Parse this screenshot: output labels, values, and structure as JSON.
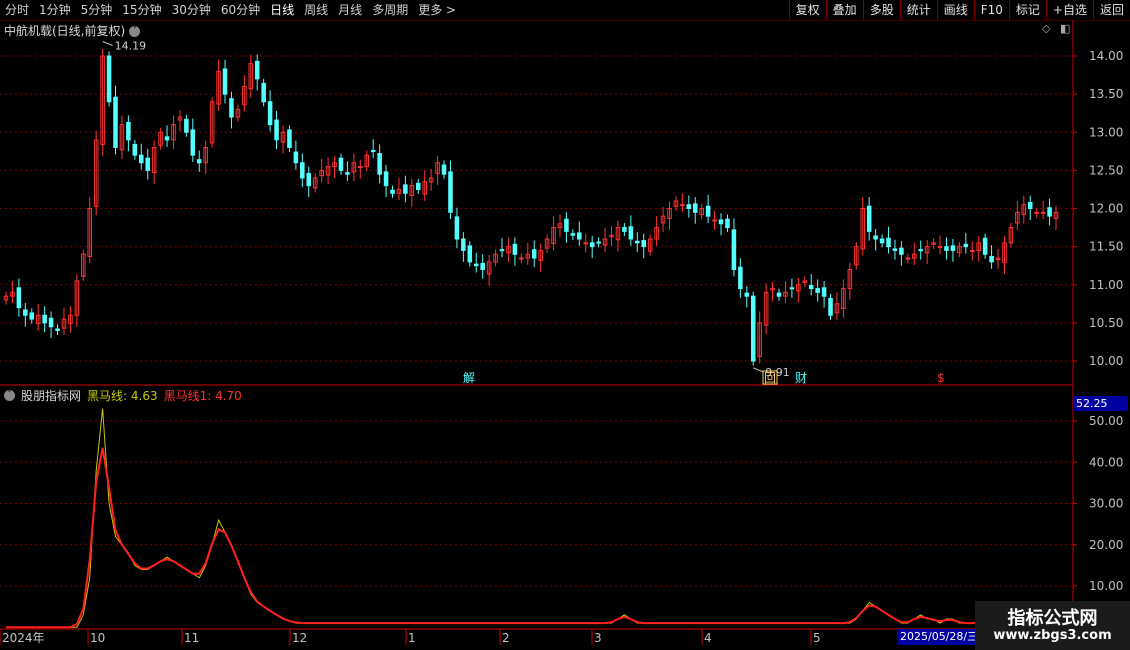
{
  "toolbar": {
    "periods": [
      "分时",
      "1分钟",
      "5分钟",
      "15分钟",
      "30分钟",
      "60分钟",
      "日线",
      "周线",
      "月线",
      "多周期",
      "更多 >"
    ],
    "active_period": "日线",
    "right_buttons": [
      "复权",
      "叠加",
      "多股",
      "统计",
      "画线",
      "F10",
      "标记",
      "+自选",
      "返回"
    ]
  },
  "main_chart": {
    "title": "中航机载(日线,前复权)",
    "high_label": "14.19",
    "low_label": "9.91",
    "price_ticks": [
      "14.00",
      "13.50",
      "13.00",
      "12.50",
      "12.00",
      "11.50",
      "11.00",
      "10.50",
      "10.00"
    ],
    "event_markers": [
      "解",
      "回",
      "财",
      "$"
    ],
    "colors": {
      "up": "#ff3232",
      "down": "#54ffff",
      "grid": "#7a0000",
      "axis": "#cc0000"
    }
  },
  "indicator": {
    "name": "股朋指标网",
    "line1_label": "黑马线: 4.63",
    "line2_label": "黑马线1: 4.70",
    "current_value": "52.25",
    "ticks": [
      "50.00",
      "40.00",
      "30.00",
      "20.00",
      "10.00"
    ]
  },
  "x_axis": {
    "labels": [
      "2024年",
      "10",
      "11",
      "12",
      "1",
      "2",
      "3",
      "4",
      "5"
    ],
    "cursor_date": "2025/05/28/三"
  },
  "watermark": {
    "line1": "指标公式网",
    "line2": "www.zbgs3.com"
  }
}
